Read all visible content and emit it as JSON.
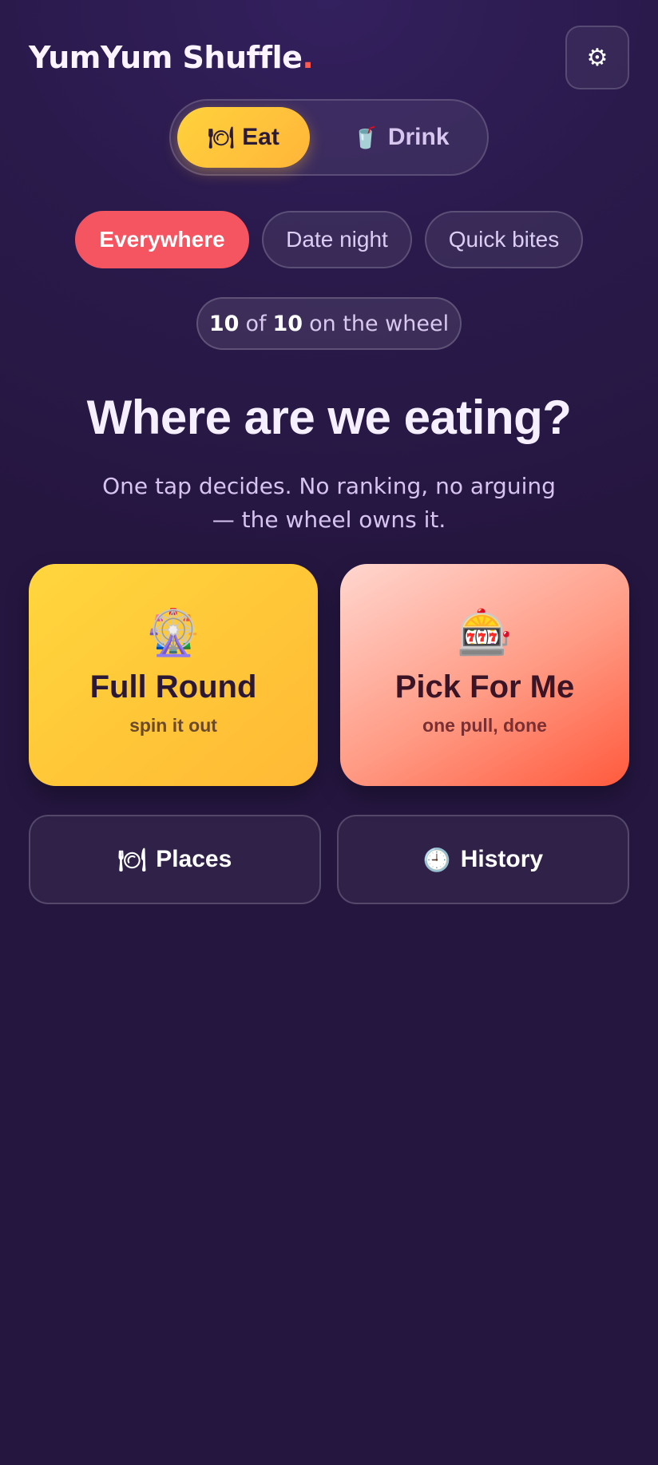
{
  "app": {
    "title": "YumYum Shuffle",
    "title_dot": ".",
    "settings_icon": "⚙"
  },
  "mode": {
    "eat": {
      "icon": "🍽",
      "label": "Eat"
    },
    "drink": {
      "icon": "🥤",
      "label": "Drink"
    },
    "selected": "eat"
  },
  "filters": [
    {
      "label": "Everywhere",
      "active": true
    },
    {
      "label": "Date night",
      "active": false
    },
    {
      "label": "Quick bites",
      "active": false
    }
  ],
  "wheel_count": {
    "current": "10",
    "of": "of",
    "total": "10",
    "suffix": "on the wheel"
  },
  "headline": "Where are we eating?",
  "subline": "One tap decides. No ranking, no arguing — the wheel owns it.",
  "cards": {
    "full_round": {
      "icon": "🎡",
      "title": "Full Round",
      "subtitle": "spin it out"
    },
    "pick_for_me": {
      "icon": "🎰",
      "title": "Pick For Me",
      "subtitle": "one pull, done"
    }
  },
  "nav": {
    "places": {
      "icon": "🍽",
      "label": "Places"
    },
    "history": {
      "icon": "🕘",
      "label": "History"
    }
  },
  "colors": {
    "accent_yellow": "#ffd23c",
    "accent_red": "#f45561",
    "background": "#2a1a4c"
  }
}
